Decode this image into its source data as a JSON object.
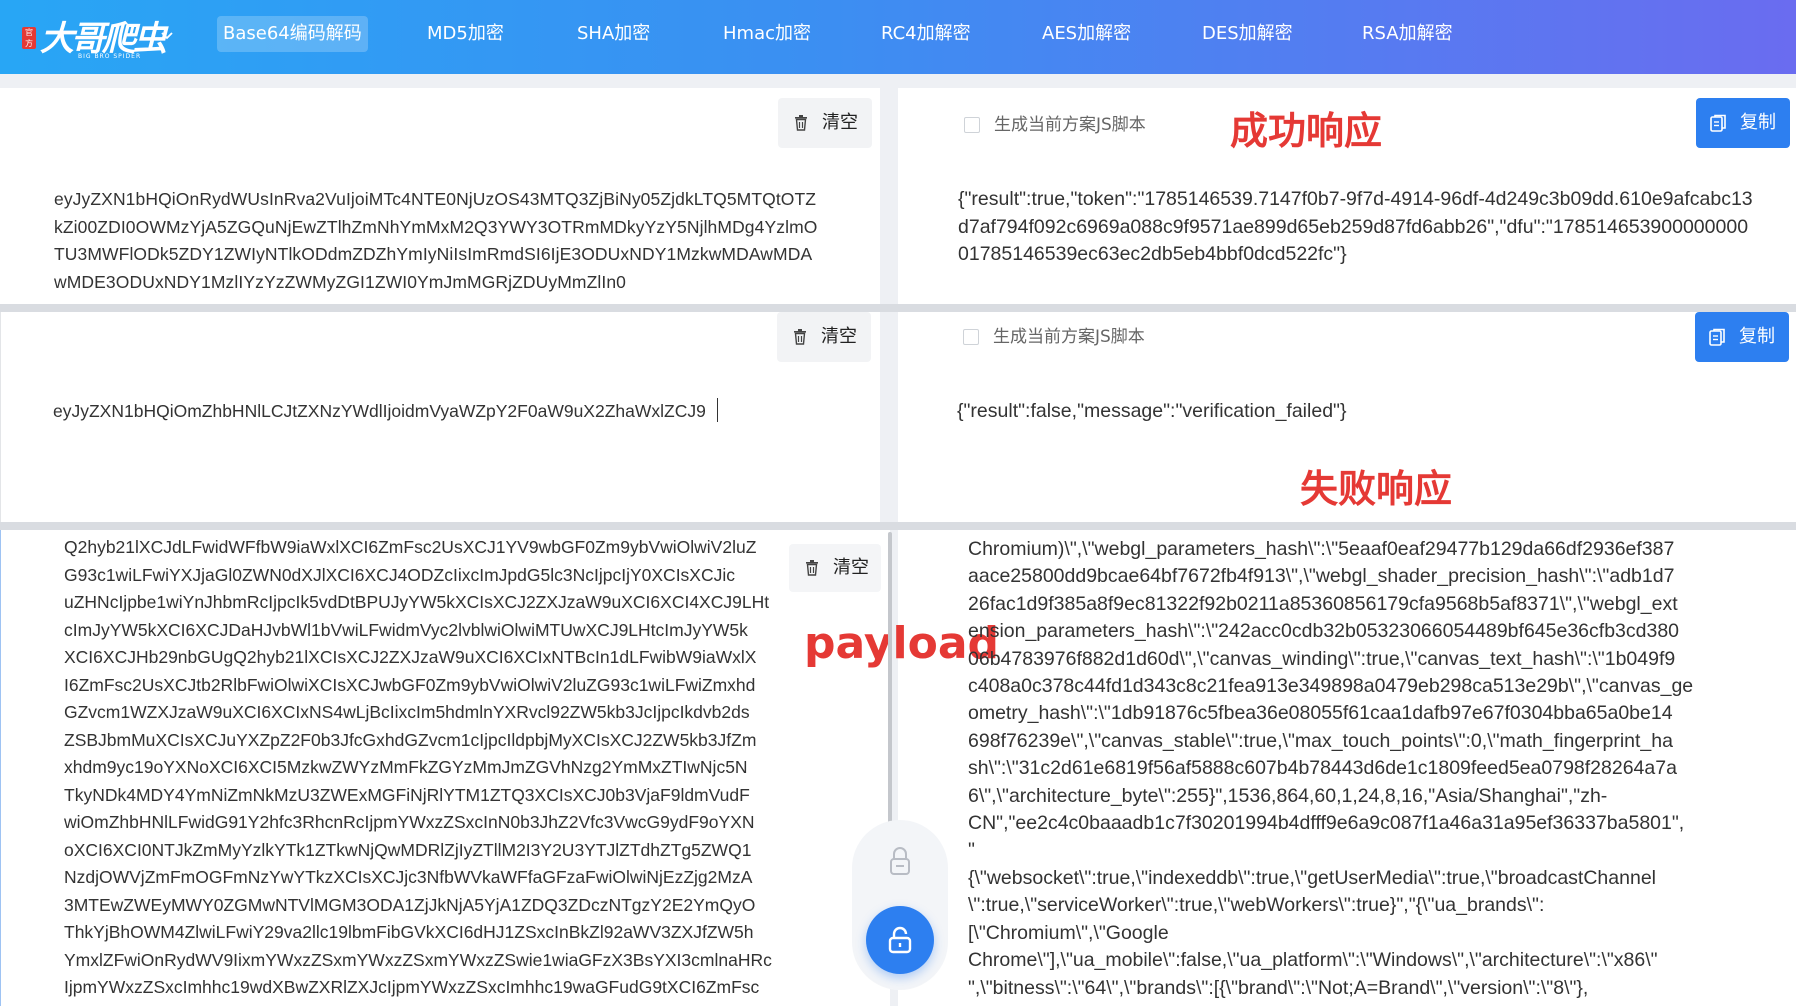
{
  "header": {
    "logo_text": "大哥爬虫",
    "logo_sub": "BIG BRO SPIDER",
    "nav": [
      {
        "label": "Base64编码解码",
        "active": true
      },
      {
        "label": "MD5加密"
      },
      {
        "label": "SHA加密"
      },
      {
        "label": "Hmac加密"
      },
      {
        "label": "RC4加解密"
      },
      {
        "label": "AES加解密"
      },
      {
        "label": "DES加解密"
      },
      {
        "label": "RSA加解密"
      }
    ]
  },
  "section1": {
    "clear_label": "清空",
    "input_text": "eyJyZXN1bHQiOnRydWUsInRva2VuIjoiMTc4NTE0NjUzOS43MTQ3ZjBiNy05ZjdkLTQ5MTQtOTZkZi00ZDI0OWMzYjA5ZGQuNjEwZTlhZmNhYmMxM2Q3YWY3OTRmMDkyYzY5NjlhMDg4YzlmOTU3MWFlODk5ZDY1ZWIyNTlkODdmZDZhYmIyNiIsImRmdSI6IjE3ODUxNDY1MzkwMDAwMDAwMDE3ODUxNDY1MzlIYzYzZWMyZGI1ZWI0YmJmMGRjZDUyMmZlIn0",
    "checkbox_label": "生成当前方案JS脚本",
    "copy_label": "复制",
    "output_text": "{\"result\":true,\"token\":\"1785146539.7147f0b7-9f7d-4914-96df-4d249c3b09dd.610e9afcabc13d7af794f092c6969a088c9f9571ae899d65eb259d87fd6abb26\",\"dfu\":\"17851465390000000001785146539ec63ec2db5eb4bbf0dcd522fc\"}",
    "annotation": "成功响应"
  },
  "section2": {
    "clear_label": "清空",
    "input_text": "eyJyZXN1bHQiOmZhbHNlLCJtZXNzYWdlIjoidmVyaWZpY2F0aW9uX2ZhaWxlZCJ9",
    "checkbox_label": "生成当前方案JS脚本",
    "copy_label": "复制",
    "output_text": "{\"result\":false,\"message\":\"verification_failed\"}",
    "annotation": "失败响应"
  },
  "section3": {
    "clear_label": "清空",
    "annotation": "payload",
    "input_lines": [
      "Q2hyb21lXCJdLFwidWFfbW9iaWxlXCI6ZmFsc2UsXCJ1YV9wbGF0Zm9ybVwiOlwiV2luZ",
      "G93c1wiLFwiYXJjaGl0ZWN0dXJlXCI6XCJ4ODZcIixcImJpdG5lc3NcIjpcIjY0XCIsXCJic",
      "uZHNcIjpbe1wiYnJhbmRcIjpcIk5vdDtBPUJyYW5kXCIsXCJ2ZXJzaW9uXCI6XCI4XCJ9LHt",
      "cImJyYW5kXCI6XCJDaHJvbWl1bVwiLFwidmVyc2lvblwiOlwiMTUwXCJ9LHtcImJyYW5k",
      "XCI6XCJHb29nbGUgQ2hyb21lXCIsXCJ2ZXJzaW9uXCI6XCIxNTBcIn1dLFwibW9iaWxlX",
      "I6ZmFsc2UsXCJtb2RlbFwiOlwiXCIsXCJwbGF0Zm9ybVwiOlwiV2luZG93c1wiLFwiZmxhd",
      "GZvcm1WZXJzaW9uXCI6XCIxNS4wLjBcIixcIm5hdmlnYXRvcl92ZW5kb3JcIjpcIkdvb2ds",
      "ZSBJbmMuXCIsXCJuYXZpZ2F0b3JfcGxhdGZvcm1cIjpcIldpbjMyXCIsXCJ2ZW5kb3JfZm",
      "xhdm9yc19oYXNoXCI6XCI5MzkwZWYzMmFkZGYzMmJmZGVhNzg2YmMxZTIwNjc5N",
      "TkyNDk4MDY4YmNiZmNkMzU3ZWExMGFiNjRlYTM1ZTQ3XCIsXCJ0b3VjaF9ldmVudF",
      "wiOmZhbHNlLFwidG91Y2hfc3RhcnRcIjpmYWxzZSxcInN0b3JhZ2Vfc3VwcG9ydF9oYXN",
      "oXCI6XCI0NTJkZmMyYzlkYTk1ZTkwNjQwMDRlZjIyZTllM2I3Y2U3YTJlZTdhZTg5ZWQ1",
      "NzdjOWVjZmFmOGFmNzYwYTkzXCIsXCJjc3NfbWVkaWFfaGFzaFwiOlwiNjEzZjg2MzA",
      "3MTEwZWEyMWY0ZGMwNTVlMGM3ODA1ZjJkNjA5YjA1ZDQ3ZDczNTgzY2E2YmQyO",
      "ThkYjBhOWM4ZlwiLFwiY29va2llc19lbmFibGVkXCI6dHJ1ZSxcInBkZl92aWV3ZXJfZW5h",
      "YmxlZFwiOnRydWV9IixmYWxzZSxmYWxzZSxmYWxzZSwie1wiaGFzX3BsYXI3cmlnaHRc",
      "IjpmYWxzZSxcImhhc19wdXBwZXRlZXJcIjpmYWxzZSxcImhhc19waGFudG9tXCI6ZmFsc"
    ],
    "output_lines": [
      "Chromium)\\\",\\\"webgl_parameters_hash\\\":\\\"5eaaf0eaf29477b129da66df2936ef387",
      "aace25800dd9bcae64bf7672fb4f913\\\",\\\"webgl_shader_precision_hash\\\":\\\"adb1d7",
      "26fac1d9f385a8f9ec81322f92b0211a85360856179cfa9568b5af8371\\\",\\\"webgl_ext",
      "ension_parameters_hash\\\":\\\"242acc0cdb32b05323066054489bf645e36cfb3cd380",
      "06b4783976f882d1d60d\\\",\\\"canvas_winding\\\":true,\\\"canvas_text_hash\\\":\\\"1b049f9",
      "c408a0c378c44fd1d343c8c21fea913e349898a0479eb298ca513e29b\\\",\\\"canvas_ge",
      "ometry_hash\\\":\\\"1db91876c5fbea36e08055f61caa1dafb97e67f0304bba65a0be14",
      "698f76239e\\\",\\\"canvas_stable\\\":true,\\\"max_touch_points\\\":0,\\\"math_fingerprint_ha",
      "sh\\\":\\\"31c2d61e6819f56af5888c607b4b78443d6de1c1809feed5ea0798f28264a7a",
      "6\\\",\\\"architecture_byte\\\":255}\",1536,864,60,1,24,8,16,\"Asia/Shanghai\",\"zh-",
      "CN\",\"ee2c4c0baaadb1c7f30201994b4dfff9e6a9c087f1a46a31a95ef36337ba5801\",",
      "\"",
      "{\\\"websocket\\\":true,\\\"indexeddb\\\":true,\\\"getUserMedia\\\":true,\\\"broadcastChannel",
      "\\\":true,\\\"serviceWorker\\\":true,\\\"webWorkers\\\":true}\",\"{\\\"ua_brands\\\":",
      "[\\\"Chromium\\\",\\\"Google",
      "Chrome\\\"],\\\"ua_mobile\\\":false,\\\"ua_platform\\\":\\\"Windows\\\",\\\"architecture\\\":\\\"x86\\\"",
      "\",\\\"bitness\\\":\\\"64\\\",\\\"brands\\\":[{\\\"brand\\\":\\\"Not;A=Brand\\\",\\\"version\\\":\\\"8\\\"},"
    ]
  },
  "colors": {
    "header_gradient_start": "#28a6f5",
    "header_gradient_end": "#6a6cf0",
    "primary_button": "#2d7ff0",
    "annotation_red": "#e53935"
  },
  "icons": {
    "clear": "trash-icon",
    "copy": "copy-icon",
    "lock": "lock-icon",
    "unlock": "unlock-icon",
    "dropdown": "chevron-down-icon"
  }
}
